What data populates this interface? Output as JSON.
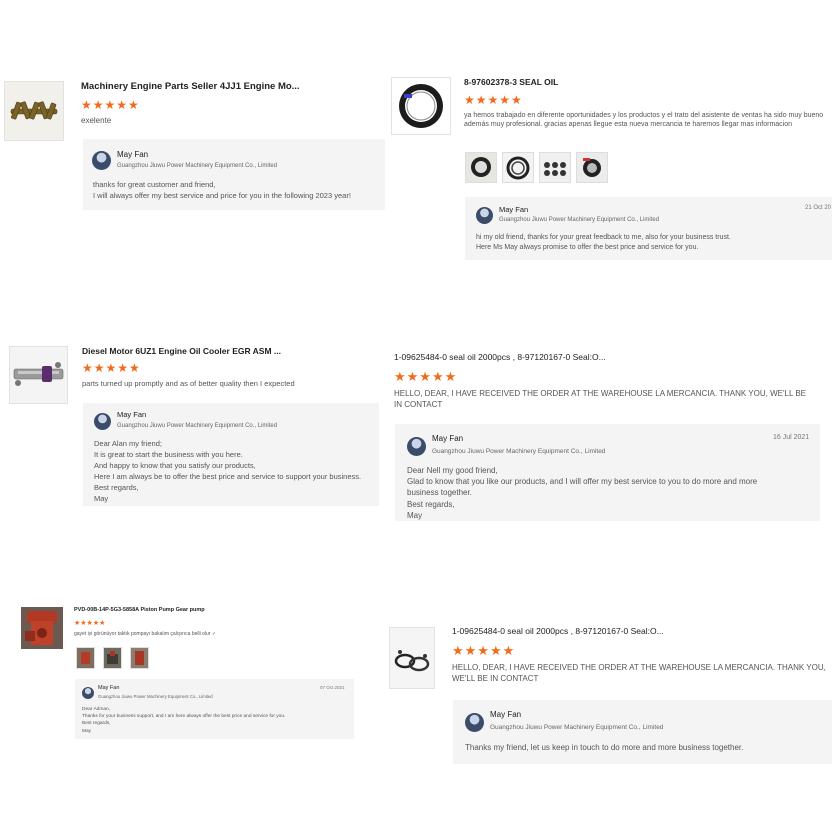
{
  "reviews": [
    {
      "title": "Machinery Engine Parts Seller 4JJ1 Engine Mo...",
      "stars": "★★★★★",
      "text": "exelente",
      "reply": {
        "name": "May Fan",
        "company": "Guangzhou Jiuwu Power Machinery Equipment Co., Limited",
        "lines": [
          "thanks for great customer and friend,",
          "I will always offer my best service and price for you in the following 2023 year!"
        ]
      }
    },
    {
      "title": "8-97602378-3 SEAL OIL",
      "stars": "★★★★★",
      "text": "ya hemos trabajado en diferente oportunidades y los productos y el trato del asistente de ventas ha sido muy bueno además muy profesional. gracias apenas llegue esta nueva mercancia te haremos llegar mas informacion",
      "reply": {
        "name": "May Fan",
        "company": "Guangzhou Jiuwu Power Machinery Equipment Co., Limited",
        "date": "21 Oct 20",
        "lines": [
          "hi my old friend, thanks for your great feedback to me, also for your business trust.",
          "Here Ms May always promise to offer the best price and service for you."
        ]
      }
    },
    {
      "title": "Diesel Motor 6UZ1 Engine Oil Cooler EGR ASM ...",
      "stars": "★★★★★",
      "text": "parts turned up promptly and as of better quality then I expected",
      "reply": {
        "name": "May Fan",
        "company": "Guangzhou Jiuwu Power Machinery Equipment Co., Limited",
        "lines": [
          "Dear Alan my friend;",
          "It is great to start the business with you here.",
          "And happy to know that you satisfy our products,",
          "Here I am always be to offer the best price and service to support your business.",
          "Best regards,",
          "May"
        ]
      }
    },
    {
      "title": "1-09625484-0 seal oil 2000pcs , 8-97120167-0 Seal:O...",
      "stars": "★★★★★",
      "text": "HELLO, DEAR, I HAVE RECEIVED THE ORDER AT THE WAREHOUSE LA MERCANCIA. THANK YOU, WE'LL BE IN CONTACT",
      "reply": {
        "name": "May Fan",
        "company": "Guangzhou Jiuwu Power Machinery Equipment Co., Limited",
        "date": "16 Jul 2021",
        "lines": [
          "Dear Nell my good friend,",
          "Glad to know that you like our products, and I will offer my best service to you to do more and more",
          "business together.",
          "Best regards,",
          "May"
        ]
      }
    },
    {
      "title": "PVD-00B-14P-5G3-5858A Piston Pump Gear pump",
      "stars": "★★★★★",
      "text": "gayet iyi görünüyor taktık pompayı bakalım çalışırıca belli olur ✓",
      "reply": {
        "name": "May Fan",
        "company": "Guangzhou Jiuwu Power Machinery Equipment Co., Limited",
        "date": "07 Oct 2021",
        "lines": [
          "Dear Adman,",
          "Thanks for your business support, and I am here always offer the best price and service for you.",
          "Best regards,",
          "May"
        ]
      }
    },
    {
      "title": "1-09625484-0 seal oil 2000pcs , 8-97120167-0 Seal:O...",
      "stars": "★★★★★",
      "text": "HELLO, DEAR, I HAVE RECEIVED THE ORDER AT THE WAREHOUSE LA MERCANCIA. THANK YOU, WE'LL BE IN CONTACT",
      "reply": {
        "name": "May Fan",
        "company": "Guangzhou Jiuwu Power Machinery Equipment Co., Limited",
        "lines": [
          "Thanks my friend, let us keep in touch to do more and more business together."
        ]
      }
    }
  ],
  "colors": {
    "star": "#f26a1b",
    "reply_bg": "#f4f4f4"
  }
}
